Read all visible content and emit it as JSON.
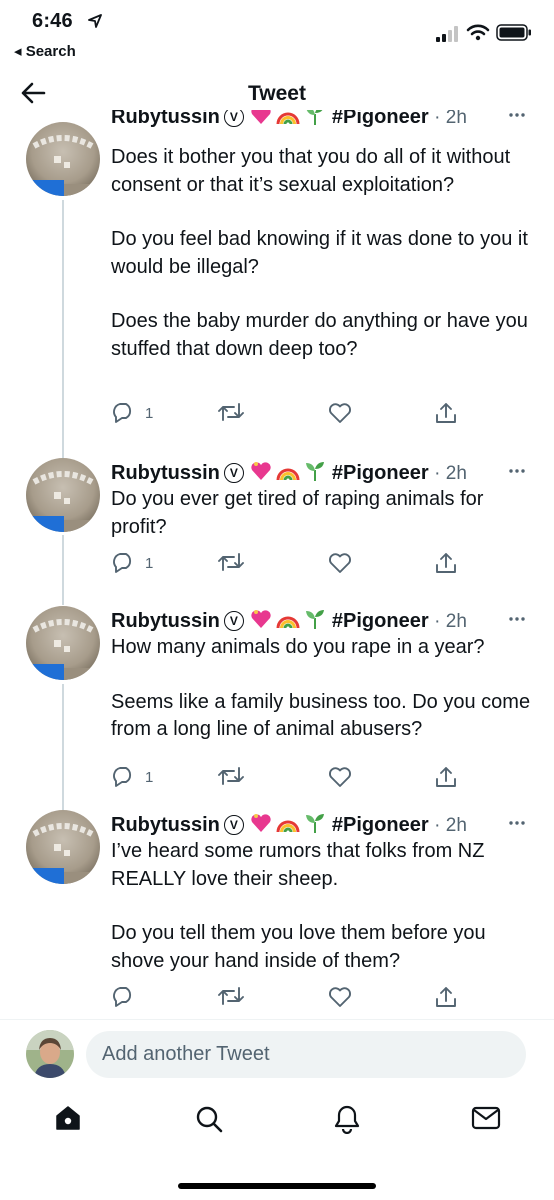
{
  "status_bar": {
    "time": "6:46",
    "back_app": "◂ Search"
  },
  "header": {
    "title": "Tweet"
  },
  "colors": {
    "text": "#0f1419",
    "secondary": "#536471",
    "thread_line": "#cfd9de",
    "input_bg": "#eff3f4"
  },
  "tweets": [
    {
      "author": "Rubytussin",
      "badge": "V",
      "hashtag": "#Pigoneer",
      "time": "· 2h",
      "text": [
        "Does it bother you that you do all of it without consent or that it’s sexual exploitation?",
        "Do you feel bad knowing if it was done to you it would be illegal?",
        "Does the baby murder do anything or have you stuffed that down deep too?"
      ],
      "reply_count": "1"
    },
    {
      "author": "Rubytussin",
      "badge": "V",
      "hashtag": "#Pigoneer",
      "time": "· 2h",
      "text": [
        "Do you ever get tired of raping animals for profit?"
      ],
      "reply_count": "1"
    },
    {
      "author": "Rubytussin",
      "badge": "V",
      "hashtag": "#Pigoneer",
      "time": "· 2h",
      "text": [
        "How many animals do you rape in a year?",
        "Seems like a family business too. Do you come from a long line of animal abusers?"
      ],
      "reply_count": "1"
    },
    {
      "author": "Rubytussin",
      "badge": "V",
      "hashtag": "#Pigoneer",
      "time": "· 2h",
      "text": [
        "I’ve heard some rumors that folks from NZ REALLY love their sheep.",
        "Do you tell them you love them before you shove your hand inside of them?"
      ],
      "reply_count": ""
    }
  ],
  "reply": {
    "placeholder": "Add another Tweet"
  },
  "icons": {
    "nav": [
      "home-icon",
      "search-icon",
      "notifications-icon",
      "messages-icon"
    ],
    "actions": [
      "reply-icon",
      "retweet-icon",
      "like-icon",
      "share-icon"
    ]
  }
}
